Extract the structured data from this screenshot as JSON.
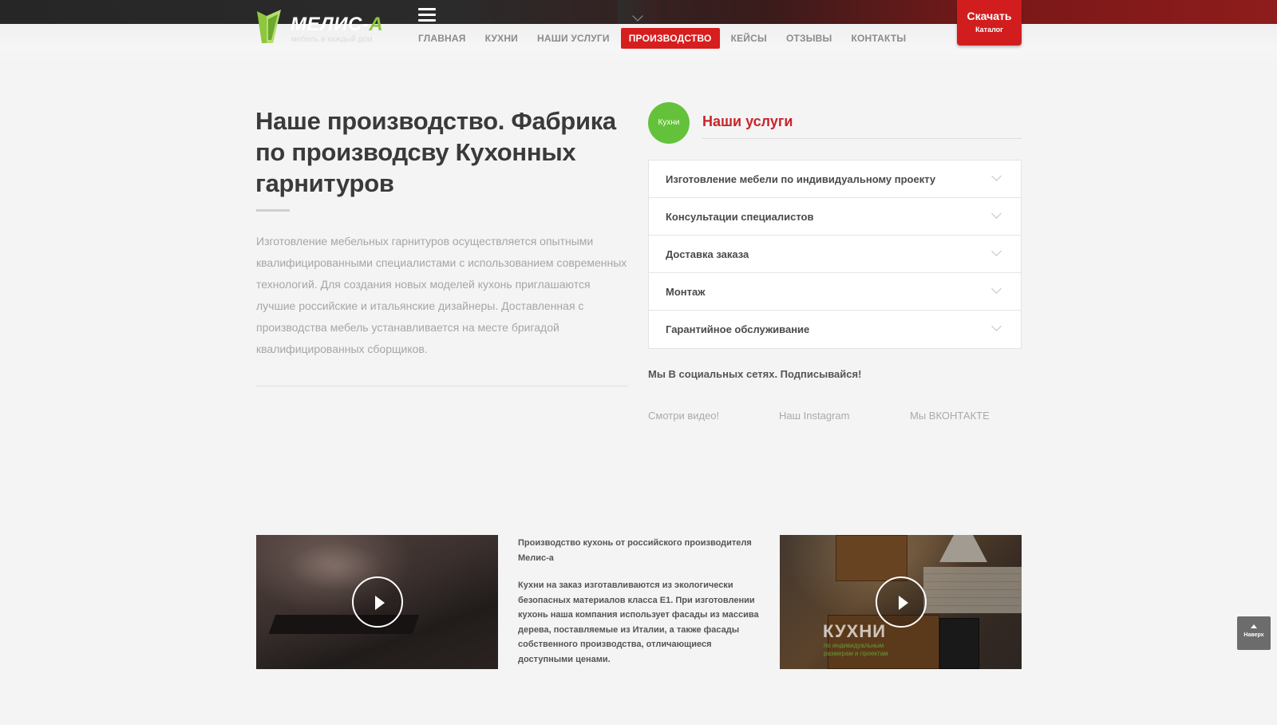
{
  "header": {
    "logo": {
      "name": "МЕЛИС-",
      "name_accent": "А",
      "tagline": "мебель в каждый дом"
    },
    "nav": [
      {
        "label": "ГЛАВНАЯ"
      },
      {
        "label": "КУХНИ"
      },
      {
        "label": "НАШИ УСЛУГИ"
      },
      {
        "label": "ПРОИЗВОДСТВО",
        "active": true
      },
      {
        "label": "КЕЙСЫ"
      },
      {
        "label": "ОТЗЫВЫ"
      },
      {
        "label": "КОНТАКТЫ"
      }
    ],
    "catalog_button": {
      "line1": "Скачать",
      "line2": "Каталог"
    }
  },
  "main": {
    "title": "Наше производство. Фабрика по производсву Кухонных гарнитуров",
    "intro": "Изготовление мебельных гарнитуров осуществляется опытными квалифицированными специалистами с использованием современных технологий. Для создания новых моделей кухонь приглашаются лучшие российские и итальянские дизайнеры. Доставленная с производства мебель устанавливается на месте бригадой квалифицированных сборщиков."
  },
  "services": {
    "badge": "Кухни",
    "title": "Наши услуги",
    "items": [
      {
        "label": "Изготовление мебели по индивидуальному проекту"
      },
      {
        "label": "Консультации специалистов"
      },
      {
        "label": "Доставка заказа"
      },
      {
        "label": "Монтаж"
      },
      {
        "label": "Гарантийное обслуживание"
      }
    ]
  },
  "social": {
    "title": "Мы В социальных сетях. Подписывайся!",
    "links": [
      {
        "label": "Смотри видео!"
      },
      {
        "label": "Наш Instagram"
      },
      {
        "label": "Мы ВКОНТАКТЕ"
      }
    ]
  },
  "videos": {
    "description_title": "Производство кухонь от российского производителя Мелис-а",
    "description_body": "Кухни на заказ изготавливаются из экологически безопасных материалов класса Е1. При изготовлении кухонь наша компания использует фасады из массива дерева, поставляемые из Италии, а также фасады собственного производства, отличающиеся доступными ценами.",
    "video2_brand": "КУХНИ",
    "video2_brand_sub": "по индивидуальным размерам и проектам"
  },
  "to_top": {
    "label": "Наверх"
  },
  "colors": {
    "accent_red": "#d71e1e",
    "brand_green": "#8dc63f",
    "badge_green": "#64c23a",
    "title_red": "#c8242b"
  }
}
